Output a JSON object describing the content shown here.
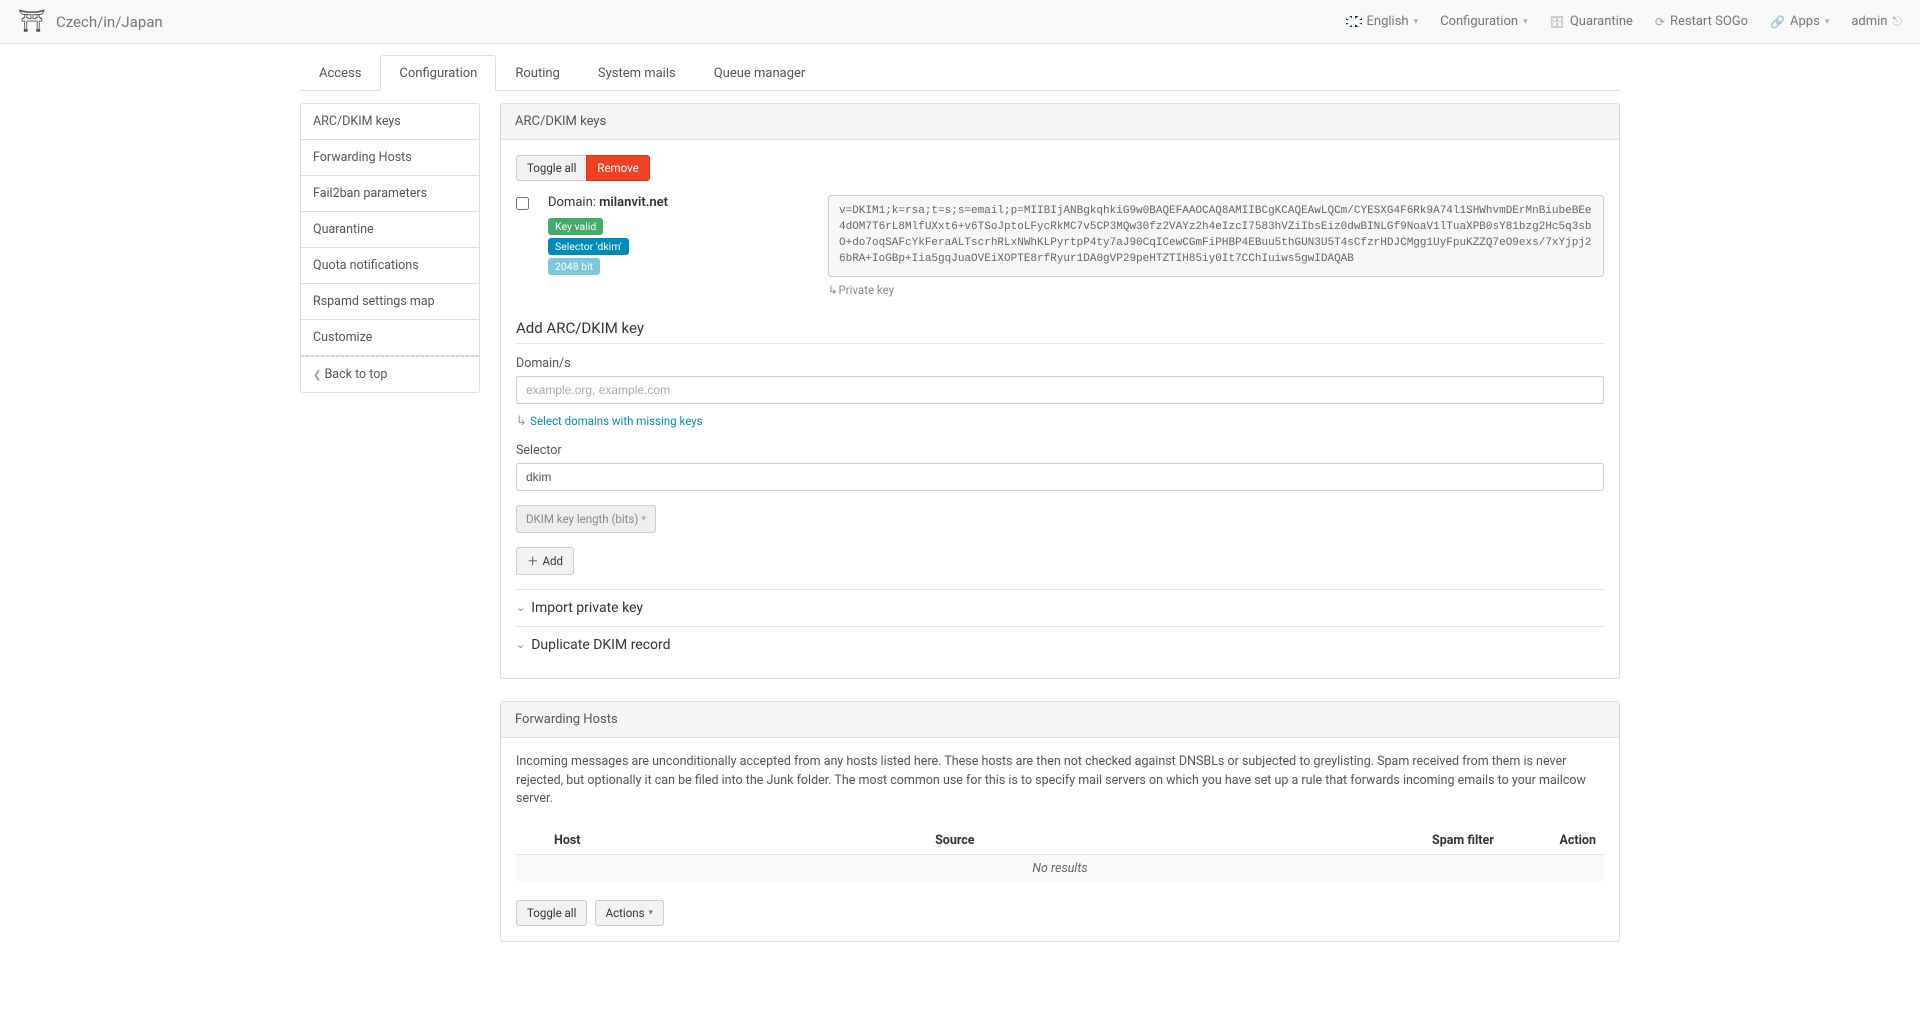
{
  "brand": "Czech/in/Japan",
  "navbar": {
    "language": "English",
    "configuration": "Configuration",
    "quarantine": "Quarantine",
    "restart": "Restart SOGo",
    "apps": "Apps",
    "user": "admin"
  },
  "tabs": {
    "access": "Access",
    "configuration": "Configuration",
    "routing": "Routing",
    "system_mails": "System mails",
    "queue": "Queue manager"
  },
  "sidebar": {
    "arc_dkim": "ARC/DKIM keys",
    "forwarding": "Forwarding Hosts",
    "fail2ban": "Fail2ban parameters",
    "quarantine": "Quarantine",
    "quota": "Quota notifications",
    "rspamd": "Rspamd settings map",
    "customize": "Customize",
    "back": "Back to top"
  },
  "dkim": {
    "heading": "ARC/DKIM keys",
    "toggle_all": "Toggle all",
    "remove": "Remove",
    "domain_label": "Domain: ",
    "domain_value": "milanvit.net",
    "badge_valid": "Key valid",
    "badge_selector": "Selector 'dkim'",
    "badge_bits": "2048 bit",
    "key_text": "v=DKIM1;k=rsa;t=s;s=email;p=MIIBIjANBgkqhkiG9w0BAQEFAAOCAQ8AMIIBCgKCAQEAwLQCm/CYESXG4F6Rk9A74l1SHWhvmDErMnBiubeBEe4dOM7T6rL8MlfUXxt6+v6TSoJptoLFycRkMC7v5CP3MQw30fz2VAYz2h4eIzcI7583hVZiIbsEiz0dwBINLGf9NoaV1lTuaXPB0sY81bzg2Hc5q3sbO+do7oqSAFcYkFeraALTscrhRLxNWhKLPyrtpP4ty7aJ90CqICewCGmFiPHBP4EBuu5thGUN3U5T4sCfzrHDJCMgg1UyFpuKZZQ7eO9exs/7xYjpj26bRA+IoGBp+Iia5gqJuaOVEiXOPTE8rfRyur1DA0gVP29peHTZTIH85iy0It7CChIuiws5gwIDAQAB",
    "private_key": "Private key"
  },
  "add_form": {
    "heading": "Add ARC/DKIM key",
    "domains_label": "Domain/s",
    "domains_placeholder": "example.org, example.com",
    "missing_link": "Select domains with missing keys",
    "selector_label": "Selector",
    "selector_value": "dkim",
    "length_placeholder": "DKIM key length (bits)",
    "add_btn": "Add"
  },
  "collapse": {
    "import": "Import private key",
    "duplicate": "Duplicate DKIM record"
  },
  "forwarding": {
    "heading": "Forwarding Hosts",
    "desc": "Incoming messages are unconditionally accepted from any hosts listed here. These hosts are then not checked against DNSBLs or subjected to greylisting. Spam received from them is never rejected, but optionally it can be filed into the Junk folder. The most common use for this is to specify mail servers on which you have set up a rule that forwards incoming emails to your mailcow server.",
    "col_host": "Host",
    "col_source": "Source",
    "col_spam": "Spam filter",
    "col_action": "Action",
    "no_results": "No results",
    "toggle_all": "Toggle all",
    "actions": "Actions"
  }
}
